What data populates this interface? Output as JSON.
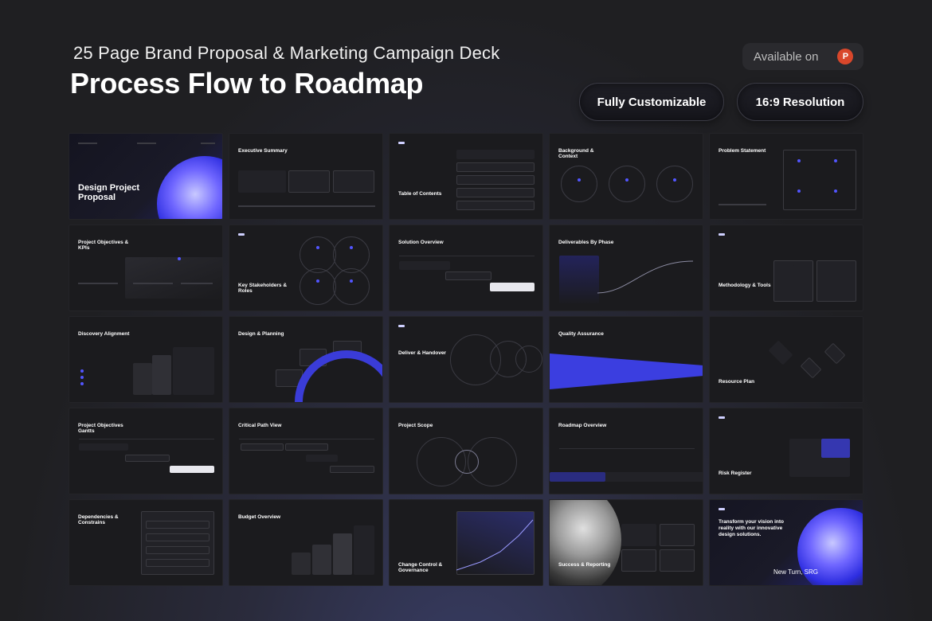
{
  "header": {
    "subtitle": "25 Page Brand Proposal & Marketing Campaign Deck",
    "title": "Process Flow to Roadmap",
    "available_label": "Available on",
    "ppt_icon_letter": "P"
  },
  "badges": {
    "customizable": "Fully Customizable",
    "resolution": "16:9 Resolution"
  },
  "slides": [
    {
      "title": "Design Project Proposal"
    },
    {
      "title": "Executive Summary"
    },
    {
      "title": "Table of Contents"
    },
    {
      "title": "Background & Context"
    },
    {
      "title": "Problem Statement"
    },
    {
      "title": "Project Objectives & KPIs"
    },
    {
      "title": "Key Stakeholders & Roles"
    },
    {
      "title": "Solution Overview"
    },
    {
      "title": "Deliverables By Phase"
    },
    {
      "title": "Methodology & Tools"
    },
    {
      "title": "Discovery Alignment"
    },
    {
      "title": "Design & Planning"
    },
    {
      "title": "Deliver & Handover"
    },
    {
      "title": "Quality Assurance"
    },
    {
      "title": "Resource Plan"
    },
    {
      "title": "Project Objectives Gantts"
    },
    {
      "title": "Critical Path View"
    },
    {
      "title": "Project Scope"
    },
    {
      "title": "Roadmap Overview"
    },
    {
      "title": "Risk Register"
    },
    {
      "title": "Dependencies & Constrains"
    },
    {
      "title": "Budget Overview"
    },
    {
      "title": "Change Control & Governance"
    },
    {
      "title": "Success & Reporting"
    },
    {
      "title": "Transform your vision into reality with our innovative design solutions.",
      "footer": "New Turn, SRG"
    }
  ],
  "colors": {
    "accent": "#4a4df0",
    "background": "#1f1f22",
    "slide": "#1b1b1e"
  }
}
